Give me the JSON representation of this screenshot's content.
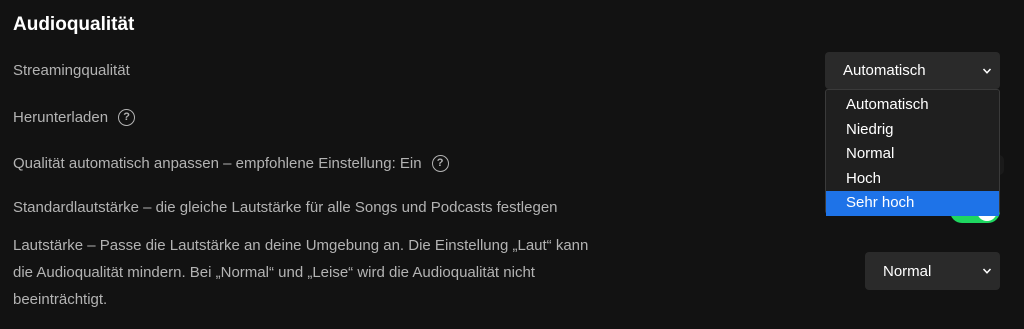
{
  "section": {
    "title": "Audioqualität"
  },
  "streaming": {
    "label": "Streamingqualität",
    "selected": "Automatisch",
    "options": [
      "Automatisch",
      "Niedrig",
      "Normal",
      "Hoch",
      "Sehr hoch"
    ],
    "highlighted": "Sehr hoch"
  },
  "download": {
    "label": "Herunterladen",
    "icon": "help-icon"
  },
  "auto_adjust": {
    "label": "Qualität automatisch anpassen – empfohlene Einstellung: Ein",
    "icon": "help-icon",
    "enabled": true
  },
  "normalize": {
    "label": "Standardlautstärke – die gleiche Lautstärke für alle Songs und Podcasts festlegen",
    "enabled": true
  },
  "volume_level": {
    "line1": "Lautstärke – Passe die Lautstärke an deine Umgebung an. Die Einstellung „Laut“ kann",
    "line2": "die Audioqualität mindern. Bei „Normal“ und „Leise“ wird die Audioqualität nicht",
    "line3": "beeinträchtigt.",
    "selected": "Normal"
  },
  "colors": {
    "background": "#121212",
    "select_bg": "#2a2a2a",
    "highlight": "#1e73e8",
    "toggle_on": "#1ed760"
  }
}
